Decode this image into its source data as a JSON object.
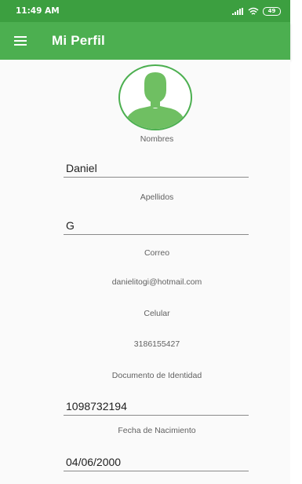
{
  "status_bar": {
    "time": "11:49 AM",
    "battery": "49"
  },
  "app_bar": {
    "title": "Mi Perfil",
    "menu_icon": "hamburger-menu-icon"
  },
  "profile": {
    "avatar_icon": "person-silhouette-icon",
    "fields": {
      "nombres": {
        "label": "Nombres",
        "value": "Daniel"
      },
      "apellidos": {
        "label": "Apellidos",
        "value": "G"
      },
      "correo": {
        "label": "Correo",
        "value": "danielitogi@hotmail.com"
      },
      "celular": {
        "label": "Celular",
        "value": "3186155427"
      },
      "documento": {
        "label": "Documento de Identidad",
        "value": "1098732194"
      },
      "fecha_nacimiento": {
        "label": "Fecha de Nacimiento",
        "value": "04/06/2000"
      }
    }
  },
  "colors": {
    "status_bar": "#3c9f40",
    "app_bar": "#4caf50",
    "accent": "#4caf50",
    "background": "#fafafa"
  }
}
